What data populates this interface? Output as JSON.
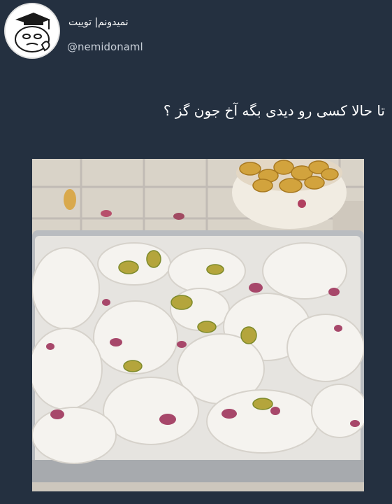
{
  "tweet": {
    "display_name": "نمیدونم| توییت",
    "username": "@nemidonaml",
    "text": "تا حالا کسی رو دیدی بگه آخ جون گز ؟"
  },
  "icons": {
    "avatar": "cartoon-graduate-face-avatar",
    "photo": "gaz-nougat-with-pistachios-and-rose-petals"
  },
  "colors": {
    "background": "#243040",
    "text": "#ffffff",
    "username": "#c6cdd6"
  }
}
